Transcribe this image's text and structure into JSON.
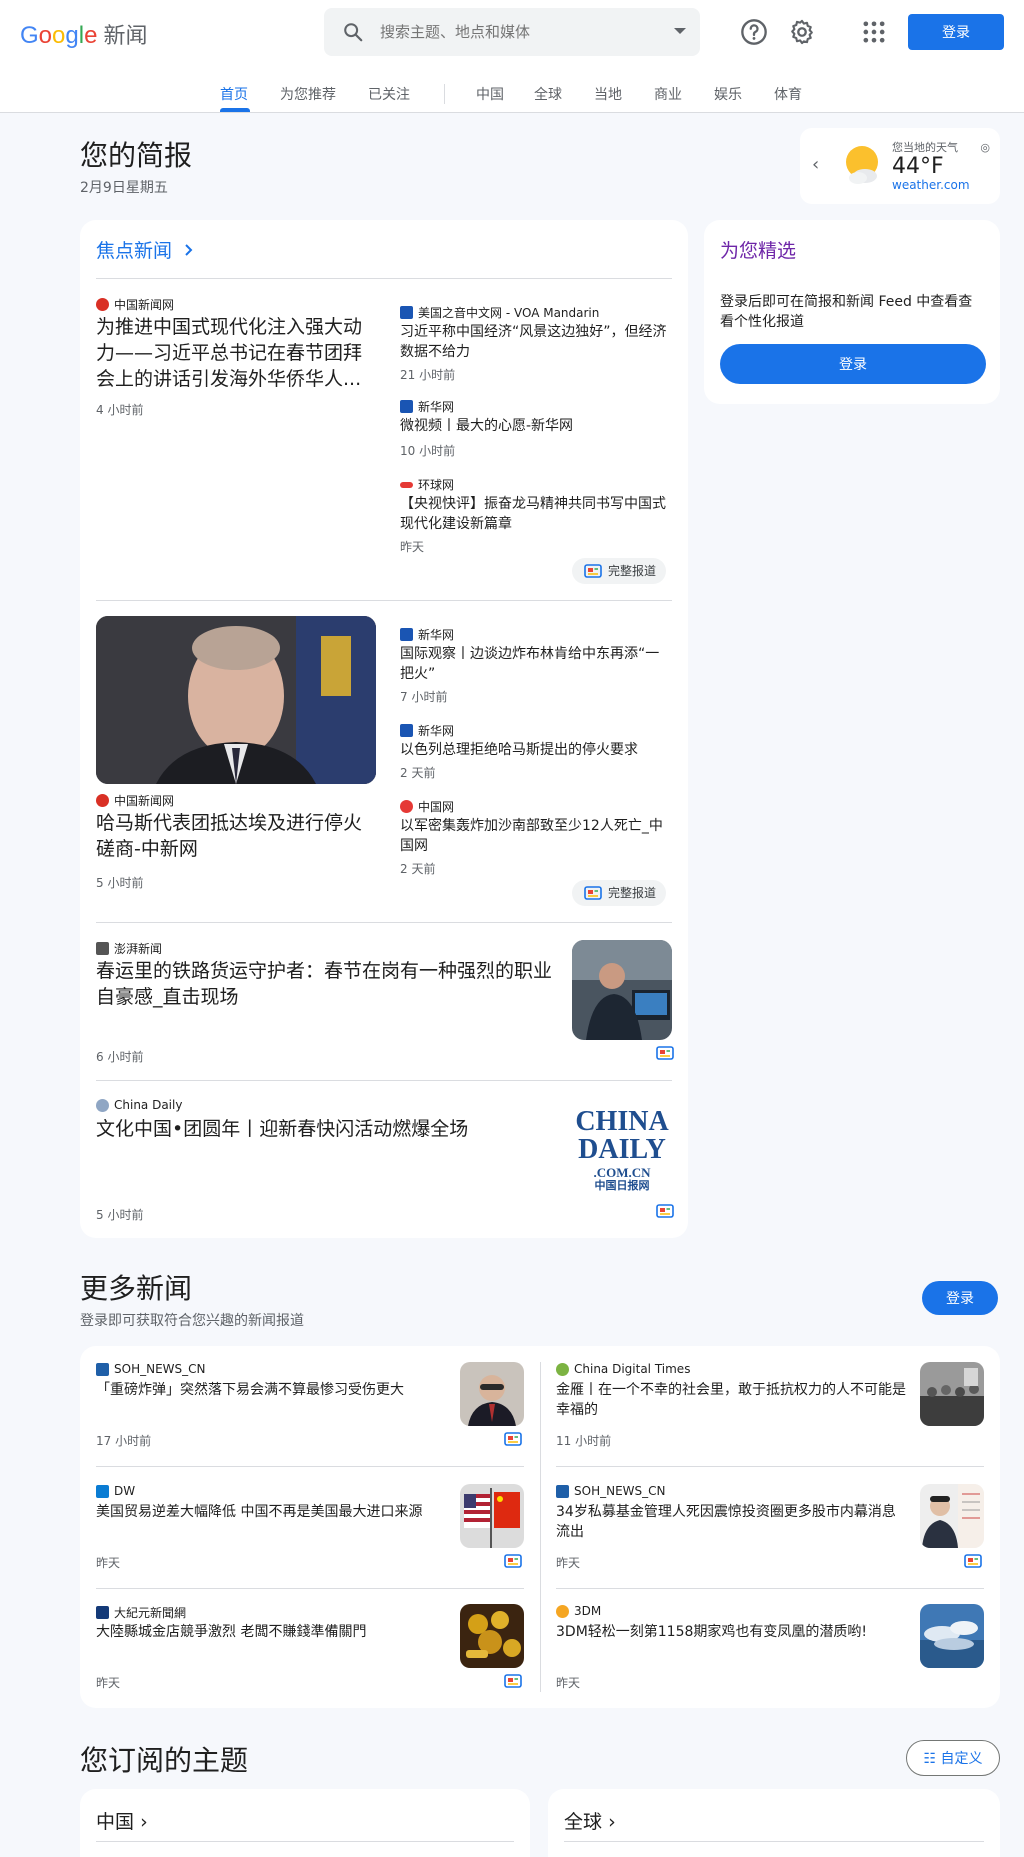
{
  "header": {
    "logo_word": "Google",
    "logo_news": "新闻",
    "search_placeholder": "搜索主题、地点和媒体",
    "login_label": "登录",
    "help_icon": "help-circle-icon",
    "settings_icon": "gear-icon",
    "apps_icon": "apps-grid-icon"
  },
  "nav": {
    "tabs": [
      "首页",
      "为您推荐",
      "已关注",
      "中国",
      "全球",
      "当地",
      "商业",
      "娱乐",
      "体育"
    ],
    "active": "首页"
  },
  "briefing": {
    "title": "您的简报",
    "date": "2月9日星期五"
  },
  "weather": {
    "label": "您当地的天气",
    "temp": "44°F",
    "source": "weather.com",
    "icon": "partly-sunny-icon"
  },
  "top_stories": {
    "title": "焦点新闻",
    "full_coverage_label": "完整报道",
    "clusters": [
      {
        "main": {
          "source": "中国新闻网",
          "headline": "为推进中国式现代化注入强大动力——习近平总书记在春节团拜会上的讲话引发海外华侨华人...",
          "time": "4 小时前"
        },
        "side": [
          {
            "source": "美国之音中文网 - VOA Mandarin",
            "headline": "习近平称中国经济“风景这边独好”，但经济数据不给力",
            "time": "21 小时前"
          },
          {
            "source": "新华网",
            "headline": "微视频丨最大的心愿-新华网",
            "time": "10 小时前"
          },
          {
            "source": "环球网",
            "headline": "【央视快评】振奋龙马精神共同书写中国式现代化建设新篇章",
            "time": "昨天"
          }
        ]
      },
      {
        "main": {
          "source": "中国新闻网",
          "headline": "哈马斯代表团抵达埃及进行停火磋商-中新网",
          "time": "5 小时前"
        },
        "side": [
          {
            "source": "新华网",
            "headline": "国际观察丨边谈边炸布林肯给中东再添“一把火”",
            "time": "7 小时前"
          },
          {
            "source": "新华网",
            "headline": "以色列总理拒绝哈马斯提出的停火要求",
            "time": "2 天前"
          },
          {
            "source": "中国网",
            "headline": "以军密集轰炸加沙南部致至少12人死亡_中国网",
            "time": "2 天前"
          }
        ]
      }
    ],
    "singles": [
      {
        "source": "澎湃新闻",
        "headline": "春运里的铁路货运守护者：春节在岗有一种强烈的职业自豪感_直击现场",
        "time": "6 小时前"
      },
      {
        "source": "China Daily",
        "headline": "文化中国•团圆年丨迎新春快闪活动燃爆全场",
        "time": "5 小时前",
        "logo_lines": [
          "CHINA",
          "DAILY",
          ".COM.CN",
          "中国日报网"
        ]
      }
    ]
  },
  "picks": {
    "title": "为您精选",
    "text": "登录后即可在简报和新闻 Feed 中查看查看个性化报道",
    "button": "登录"
  },
  "more_news": {
    "title": "更多新闻",
    "subtitle": "登录即可获取符合您兴趣的新闻报道",
    "button": "登录",
    "items": [
      {
        "source": "SOH_NEWS_CN",
        "headline": "「重磅炸弹」突然落下易会满不算最惨习受伤更大",
        "time": "17 小时前"
      },
      {
        "source": "China Digital Times",
        "headline": "金雁丨在一个不幸的社会里，敢于抵抗权力的人不可能是幸福的",
        "time": "11 小时前"
      },
      {
        "source": "DW",
        "headline": "美国贸易逆差大幅降低 中国不再是美国最大进口来源",
        "time": "昨天"
      },
      {
        "source": "SOH_NEWS_CN",
        "headline": "34岁私募基金管理人死因震惊投资圈更多股市内幕消息流出",
        "time": "昨天"
      },
      {
        "source": "大紀元新聞網",
        "headline": "大陸縣城金店競爭激烈 老闆不賺錢準備關門",
        "time": "昨天"
      },
      {
        "source": "3DM",
        "headline": "3DM轻松一刻第1158期家鸡也有变凤凰的潜质哟!",
        "time": "昨天"
      }
    ]
  },
  "topics": {
    "title": "您订阅的主题",
    "customize": "自定义",
    "cards": [
      "中国",
      "全球"
    ]
  }
}
